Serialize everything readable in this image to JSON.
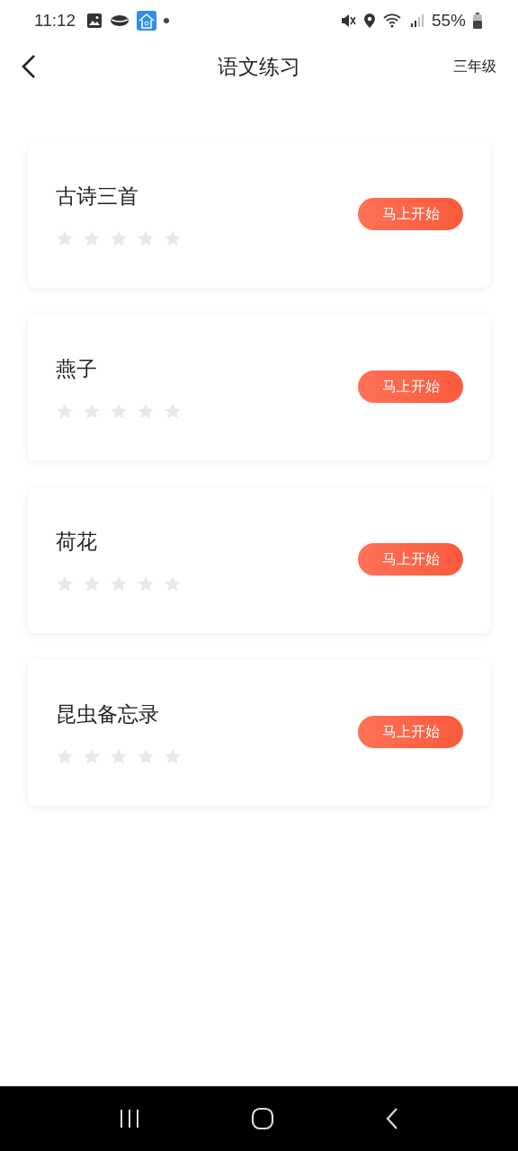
{
  "status_bar": {
    "time": "11:12",
    "battery": "55%"
  },
  "header": {
    "title": "语文练习",
    "grade": "三年级"
  },
  "lessons": [
    {
      "title": "古诗三首",
      "stars": 0,
      "button": "马上开始"
    },
    {
      "title": "燕子",
      "stars": 0,
      "button": "马上开始"
    },
    {
      "title": "荷花",
      "stars": 0,
      "button": "马上开始"
    },
    {
      "title": "昆虫备忘录",
      "stars": 0,
      "button": "马上开始"
    }
  ]
}
